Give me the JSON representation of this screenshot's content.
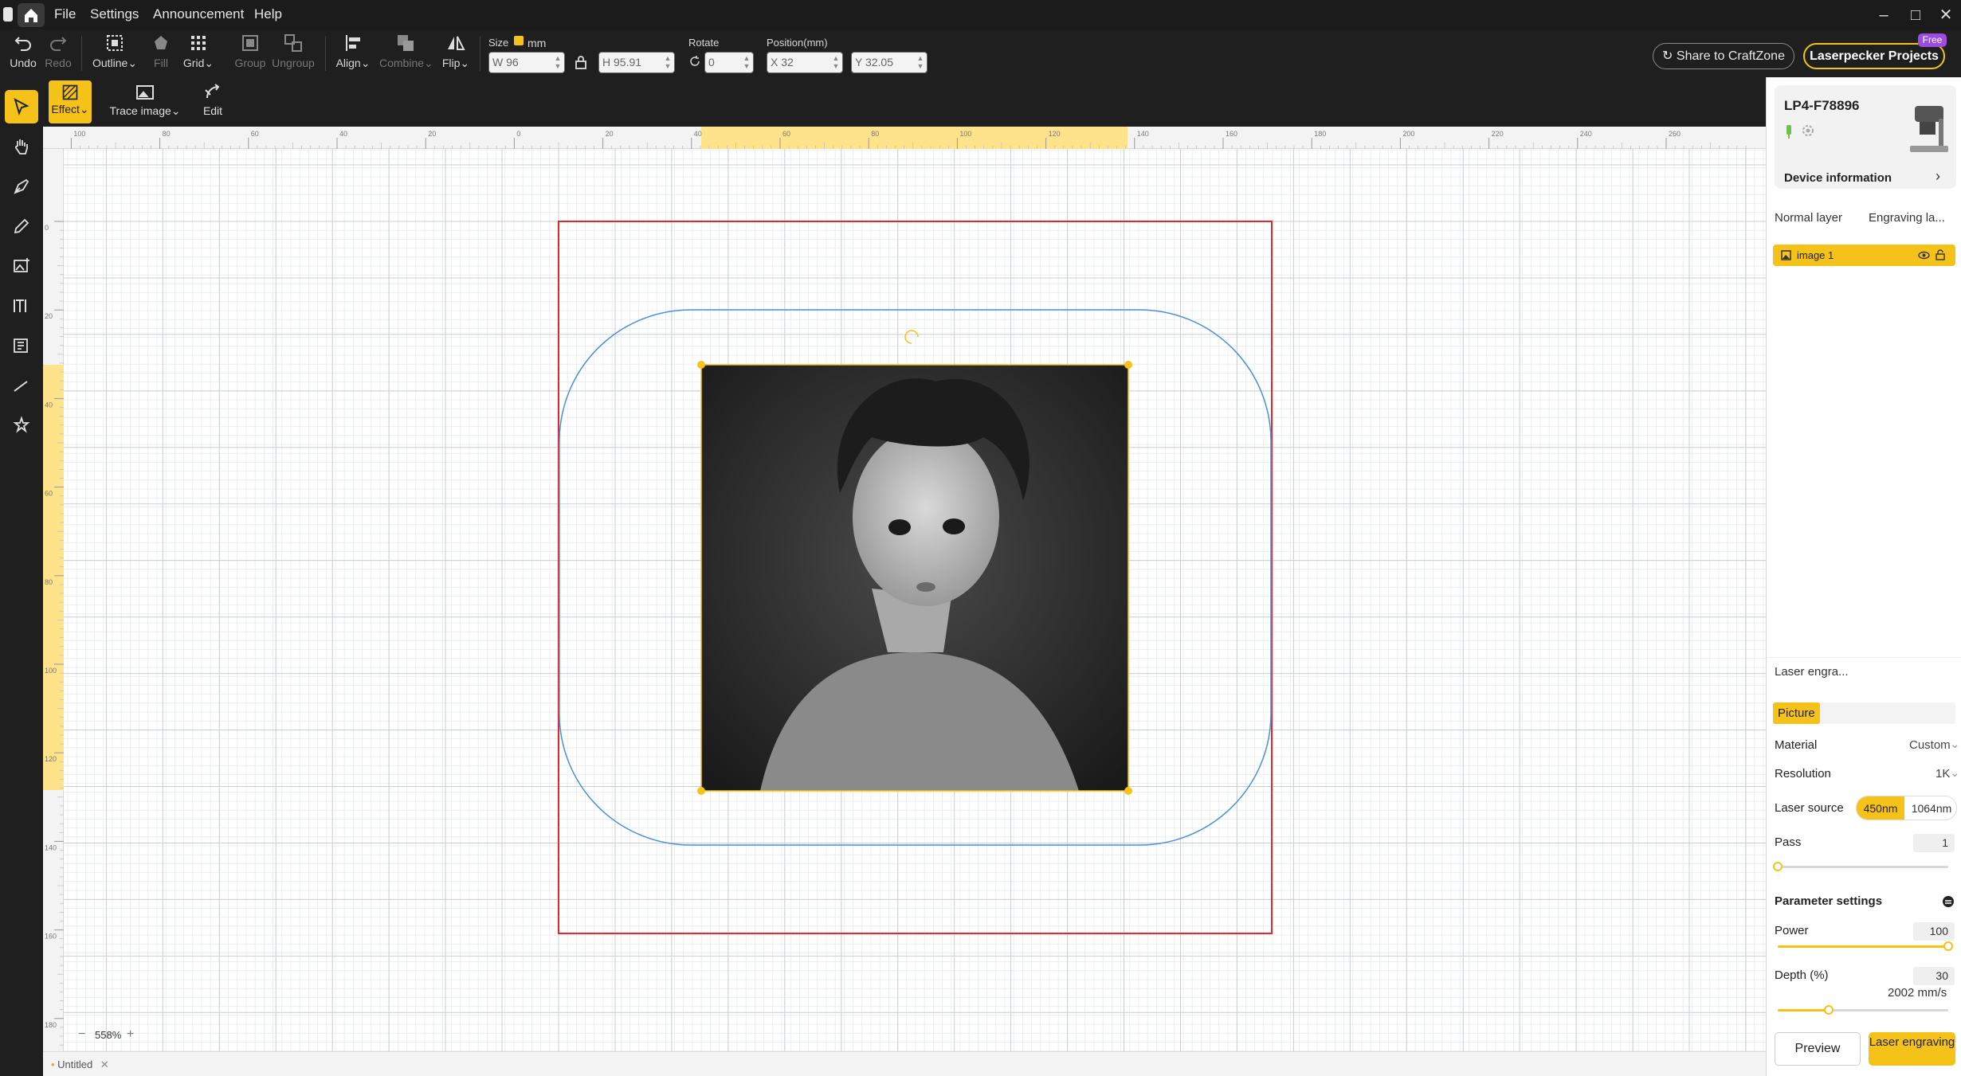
{
  "titlebar": {
    "menus": [
      "File",
      "Settings",
      "Announcement",
      "Help"
    ]
  },
  "toolbar": {
    "undo": "Undo",
    "redo": "Redo",
    "outline": "Outline",
    "fill": "Fill",
    "grid": "Grid",
    "group": "Group",
    "ungroup": "Ungroup",
    "align": "Align",
    "combine": "Combine",
    "flip": "Flip",
    "size_label": "Size",
    "unit": "mm",
    "width": "W 96",
    "height": "H 95.91",
    "rotate_label": "Rotate",
    "rotate_value": "0",
    "position_label": "Position(mm)",
    "pos_x": "X 32",
    "pos_y": "Y 32.05",
    "share": "Share to CraftZone",
    "projects": "Laserpecker Projects",
    "free_badge": "Free"
  },
  "subbar": {
    "effect": "Effect",
    "trace": "Trace image",
    "edit": "Edit"
  },
  "ruler": {
    "top_ticks": [
      "100",
      "80",
      "60",
      "40",
      "20",
      "0",
      "20",
      "40",
      "60",
      "80",
      "100",
      "120",
      "140",
      "160",
      "180",
      "200",
      "220",
      "240",
      "260"
    ],
    "left_ticks": [
      "0",
      "20",
      "40",
      "60",
      "80",
      "100",
      "120",
      "140",
      "160",
      "180"
    ]
  },
  "canvas": {
    "zoom": "558%",
    "tab": "Untitled"
  },
  "panel": {
    "device_name": "LP4-F78896",
    "device_info": "Device information",
    "tab_normal": "Normal layer",
    "tab_engraving": "Engraving la...",
    "layer_name": "image 1",
    "laser_tab": "Laser engra...",
    "picture": "Picture",
    "material_label": "Material",
    "material_value": "Custom",
    "resolution_label": "Resolution",
    "resolution_value": "1K",
    "laser_source_label": "Laser source",
    "laser_450": "450nm",
    "laser_1064": "1064nm",
    "pass_label": "Pass",
    "pass_value": "1",
    "param_settings": "Parameter settings",
    "power_label": "Power",
    "power_value": "100",
    "depth_label": "Depth (%)",
    "depth_value": "30",
    "speed": "2002 mm/s",
    "preview": "Preview",
    "engrave": "Laser engraving"
  },
  "sliders": {
    "pass_fraction": 0.0,
    "power_fraction": 1.0,
    "depth_fraction": 0.3
  },
  "colors": {
    "accent": "#f5c21a",
    "dark_bar": "#1f1f1f",
    "work_area": "#e8262a",
    "outline": "#4a90d9",
    "badge": "#9b4dde"
  }
}
